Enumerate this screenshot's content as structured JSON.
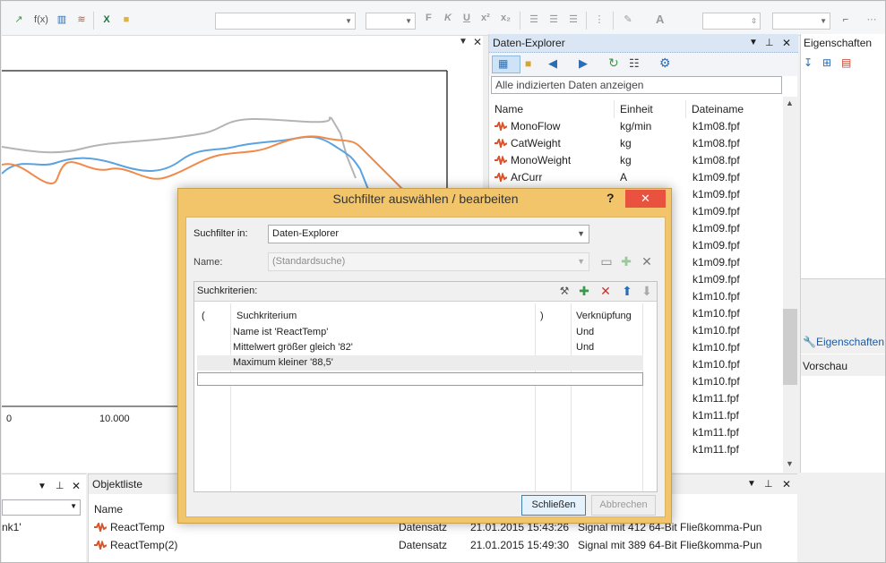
{
  "colors": {
    "accent": "#3c7fb1",
    "dialog_frame": "#f2c56b",
    "close": "#e9523f",
    "series1": "#f08a4b",
    "series2": "#5ba3e0",
    "series3": "#b4b4b4"
  },
  "toolbar": {
    "fx_label": "f(x)",
    "font_combo": "",
    "size_combo": "",
    "bold": "F",
    "italic": "K",
    "underline": "U",
    "superscript": "x²",
    "subscript": "x₂",
    "font_color": "A"
  },
  "chart": {
    "tick_left": "0",
    "tick_mid": "10.000"
  },
  "explorer": {
    "title": "Daten-Explorer",
    "filter_text": "Alle indizierten Daten anzeigen",
    "columns": [
      "Name",
      "Einheit",
      "Dateiname"
    ],
    "rows": [
      {
        "name": "MonoFlow",
        "unit": "kg/min",
        "file": "k1m08.fpf"
      },
      {
        "name": "CatWeight",
        "unit": "kg",
        "file": "k1m08.fpf"
      },
      {
        "name": "MonoWeight",
        "unit": "kg",
        "file": "k1m08.fpf"
      },
      {
        "name": "ArCurr",
        "unit": "A",
        "file": "k1m09.fpf"
      },
      {
        "name": "",
        "unit": "",
        "file": "k1m09.fpf"
      },
      {
        "name": "",
        "unit": "",
        "file": "k1m09.fpf"
      },
      {
        "name": "",
        "unit": "",
        "file": "k1m09.fpf"
      },
      {
        "name": "",
        "unit": "",
        "file": "k1m09.fpf"
      },
      {
        "name": "",
        "unit": "",
        "file": "k1m09.fpf"
      },
      {
        "name": "",
        "unit": "",
        "file": "k1m09.fpf"
      },
      {
        "name": "",
        "unit": "",
        "file": "k1m10.fpf"
      },
      {
        "name": "",
        "unit": "",
        "file": "k1m10.fpf"
      },
      {
        "name": "",
        "unit": "",
        "file": "k1m10.fpf"
      },
      {
        "name": "",
        "unit": "",
        "file": "k1m10.fpf"
      },
      {
        "name": "",
        "unit": "",
        "file": "k1m10.fpf"
      },
      {
        "name": "",
        "unit": "",
        "file": "k1m10.fpf"
      },
      {
        "name": "",
        "unit": "",
        "file": "k1m11.fpf"
      },
      {
        "name": "",
        "unit": "",
        "file": "k1m11.fpf"
      },
      {
        "name": "",
        "unit": "",
        "file": "k1m11.fpf"
      },
      {
        "name": "",
        "unit": "",
        "file": "k1m11.fpf"
      }
    ]
  },
  "properties": {
    "title": "Eigenschaften",
    "tab_label": "Eigenschaften",
    "preview_title": "Vorschau"
  },
  "bottom_left": {
    "item_text": "nk1'"
  },
  "objlist": {
    "title": "Objektliste",
    "column_name": "Name",
    "rows": [
      {
        "name": "ReactTemp",
        "type": "Datensatz",
        "date": "21.01.2015 15:43:26",
        "desc": "Signal mit 412 64-Bit Fließkomma-Pun"
      },
      {
        "name": "ReactTemp(2)",
        "type": "Datensatz",
        "date": "21.01.2015 15:49:30",
        "desc": "Signal mit 389 64-Bit Fließkomma-Pun"
      }
    ]
  },
  "dialog": {
    "title": "Suchfilter auswählen / bearbeiten",
    "help": "?",
    "close": "✕",
    "filter_in_label": "Suchfilter in:",
    "filter_in_value": "Daten-Explorer",
    "name_label": "Name:",
    "name_value": "(Standardsuche)",
    "criteria_label": "Suchkriterien:",
    "columns": {
      "open_paren": "(",
      "criterion": "Suchkriterium",
      "close_paren": ")",
      "link": "Verknüpfung"
    },
    "criteria": [
      {
        "criterion": "Name ist 'ReactTemp'",
        "link": "Und"
      },
      {
        "criterion": "Mittelwert größer gleich '82'",
        "link": "Und"
      },
      {
        "criterion": "Maximum kleiner '88,5'",
        "link": ""
      }
    ],
    "close_button": "Schließen",
    "cancel_button": "Abbrechen"
  }
}
